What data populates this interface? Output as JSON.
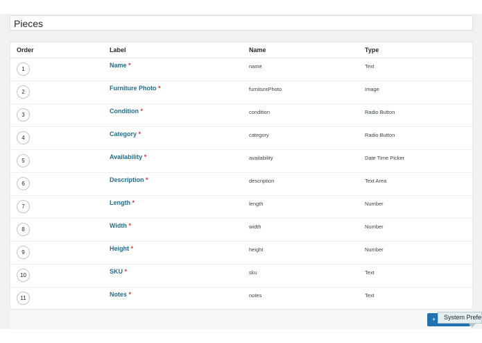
{
  "page": {
    "title": "Pieces"
  },
  "table": {
    "headers": {
      "order": "Order",
      "label": "Label",
      "name": "Name",
      "type": "Type"
    },
    "rows": [
      {
        "order": "1",
        "label": "Name",
        "name": "name",
        "type": "Text"
      },
      {
        "order": "2",
        "label": "Furniture Photo",
        "name": "furniturePhoto",
        "type": "Image"
      },
      {
        "order": "3",
        "label": "Condition",
        "name": "condition",
        "type": "Radio Button"
      },
      {
        "order": "4",
        "label": "Category",
        "name": "category",
        "type": "Radio Button"
      },
      {
        "order": "5",
        "label": "Availability",
        "name": "availability",
        "type": "Date Time Picker"
      },
      {
        "order": "6",
        "label": "Description",
        "name": "description",
        "type": "Text Area"
      },
      {
        "order": "7",
        "label": "Length",
        "name": "length",
        "type": "Number"
      },
      {
        "order": "8",
        "label": "Width",
        "name": "width",
        "type": "Number"
      },
      {
        "order": "9",
        "label": "Height",
        "name": "height",
        "type": "Number"
      },
      {
        "order": "10",
        "label": "SKU",
        "name": "sku",
        "type": "Text"
      },
      {
        "order": "11",
        "label": "Notes",
        "name": "notes",
        "type": "Text"
      }
    ],
    "required_mark": "*"
  },
  "footer": {
    "add_button_label": "+",
    "tooltip": "System Preferences"
  },
  "colors": {
    "link": "#1d6e93",
    "required": "#d63638",
    "primary_button": "#2271b1"
  }
}
